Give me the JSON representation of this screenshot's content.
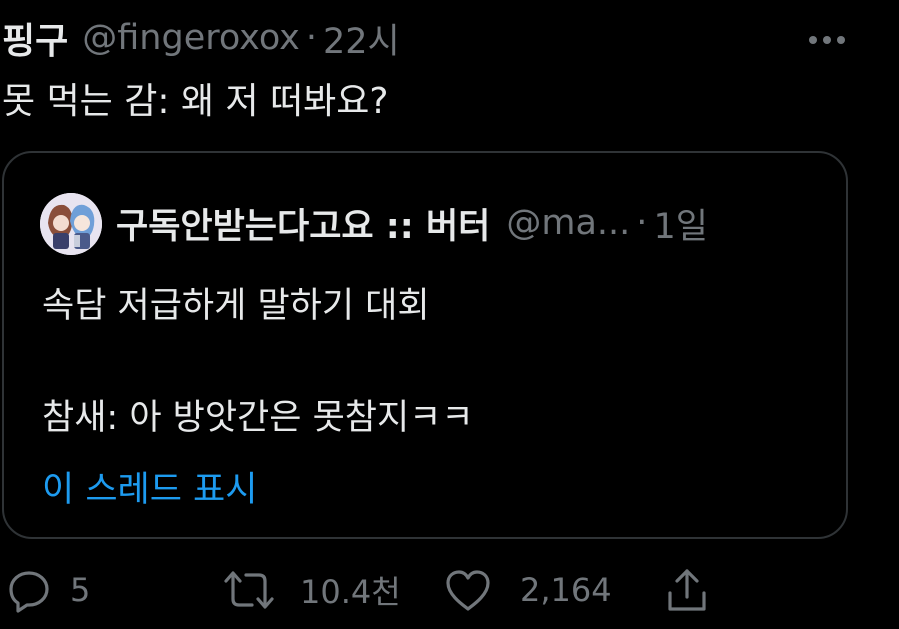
{
  "tweet": {
    "author_name": "핑구",
    "author_handle": "@fingeroxox",
    "separator": "·",
    "time": "22시",
    "text": "못 먹는 감: 왜 저 떠봐요?"
  },
  "quote": {
    "author_name": "구독안받는다고요 :: 버터",
    "author_handle": "@ma...",
    "separator": "·",
    "time": "1일",
    "line1": "속담 저급하게 말하기 대회",
    "line2": "참새: 아 방앗간은 못참지ㅋㅋ",
    "show_thread": "이 스레드 표시"
  },
  "actions": {
    "reply_count": "5",
    "retweet_count": "10.4천",
    "like_count": "2,164"
  },
  "colors": {
    "background": "#000000",
    "text_primary": "#e7e9ea",
    "text_secondary": "#71767b",
    "link": "#1d9bf0",
    "border": "#2f3336"
  },
  "icons": {
    "more": "more-horizontal-icon",
    "reply": "reply-icon",
    "retweet": "retweet-icon",
    "like": "heart-icon",
    "share": "share-icon",
    "avatar": "avatar-image"
  }
}
